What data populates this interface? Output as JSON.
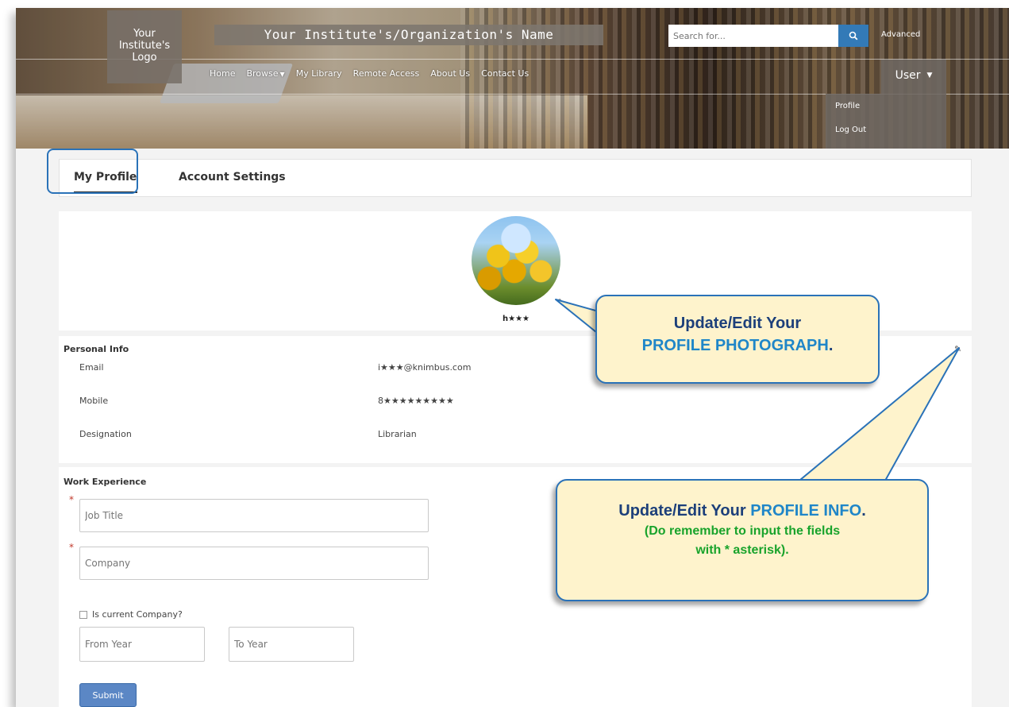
{
  "header": {
    "logo_text": "Your Institute's Logo",
    "org_name": "Your Institute's/Organization's Name",
    "search_placeholder": "Search for...",
    "advanced_label": "Advanced",
    "nav": [
      "Home",
      "Browse",
      "My Library",
      "Remote Access",
      "About Us",
      "Contact Us"
    ],
    "user_label": "User",
    "user_menu": [
      "Profile",
      "Log Out"
    ]
  },
  "tabs": [
    "My Profile",
    "Account Settings"
  ],
  "profile": {
    "name": "h★★★",
    "personal_info_title": "Personal Info",
    "fields": [
      {
        "label": "Email",
        "value": "i★★★@knimbus.com"
      },
      {
        "label": "Mobile",
        "value": "8★★★★★★★★★"
      },
      {
        "label": "Designation",
        "value": "Librarian"
      }
    ]
  },
  "work": {
    "title": "Work Experience",
    "required_mark": "*",
    "job_title_placeholder": "Job Title",
    "company_placeholder": "Company",
    "current_company_label": "Is current Company?",
    "from_year_placeholder": "From Year",
    "to_year_placeholder": "To Year",
    "submit_label": "Submit"
  },
  "callouts": {
    "photo_line1": "Update/Edit Your",
    "photo_kw": "PROFILE PHOTOGRAPH",
    "photo_tail": ".",
    "info_line1": "Update/Edit Your ",
    "info_kw": "PROFILE INFO",
    "info_tail": ".",
    "info_note1": "(Do remember to input the fields",
    "info_note2": "with * asterisk)."
  },
  "colors": {
    "accent": "#2a72b8",
    "callout_bg": "#fef3cc",
    "callout_text": "#1c3f7a",
    "keyword": "#1f86c8",
    "note": "#18a32b",
    "submit": "#5b87c5"
  }
}
